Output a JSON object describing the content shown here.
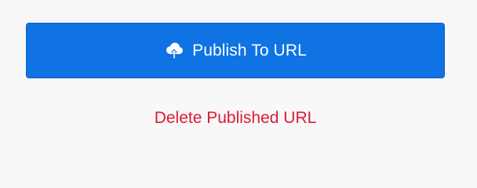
{
  "publish_button": {
    "label": "Publish To URL",
    "icon": "cloud-upload-icon"
  },
  "delete_link": {
    "label": "Delete Published URL"
  },
  "colors": {
    "background": "#f8f8f8",
    "primary": "#0f73e3",
    "danger": "#dd1a36"
  }
}
